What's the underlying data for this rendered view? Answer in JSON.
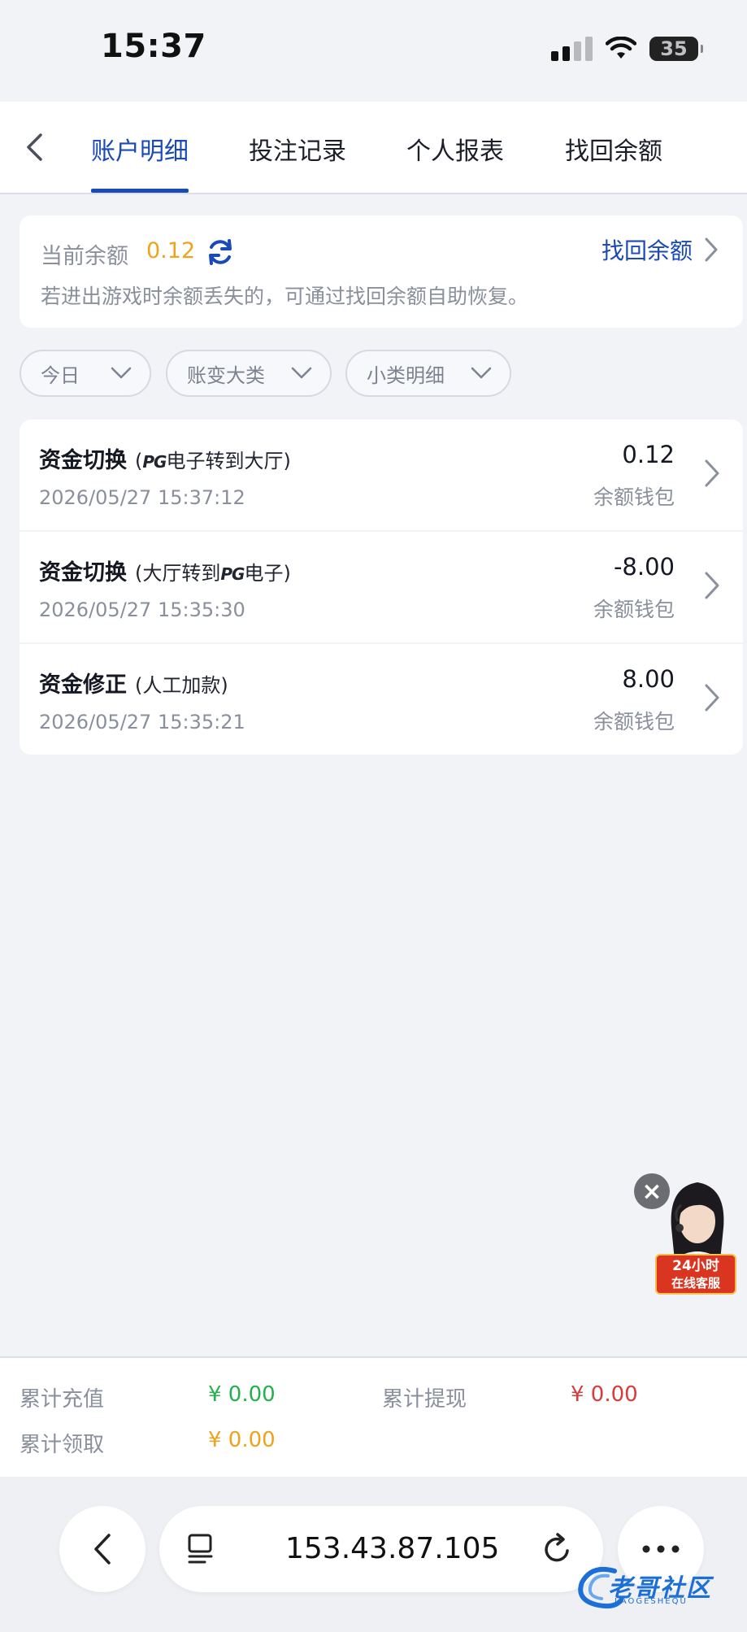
{
  "status_bar": {
    "time": "15:37",
    "battery": "35"
  },
  "tabs": [
    {
      "label": "账户明细",
      "active": true
    },
    {
      "label": "投注记录",
      "active": false
    },
    {
      "label": "个人报表",
      "active": false
    },
    {
      "label": "找回余额",
      "active": false
    }
  ],
  "balance": {
    "label": "当前余额",
    "value": "0.12",
    "recover_label": "找回余额",
    "hint": "若进出游戏时余额丢失的，可通过找回余额自助恢复。"
  },
  "filters": [
    {
      "label": "今日"
    },
    {
      "label": "账变大类"
    },
    {
      "label": "小类明细"
    }
  ],
  "records": [
    {
      "title": "资金切换",
      "sub_pre": "(",
      "sub_pg1": "PG",
      "sub_mid": "电子转到大厅)",
      "time": "2026/05/27 15:37:12",
      "amount": "0.12",
      "wallet": "余额钱包"
    },
    {
      "title": "资金切换",
      "sub_pre": "(大厅转到",
      "sub_pg1": "PG",
      "sub_mid": "电子)",
      "time": "2026/05/27 15:35:30",
      "amount": "-8.00",
      "wallet": "余额钱包"
    },
    {
      "title": "资金修正",
      "sub_pre": "(人工加款)",
      "sub_pg1": "",
      "sub_mid": "",
      "time": "2026/05/27 15:35:21",
      "amount": "8.00",
      "wallet": "余额钱包"
    }
  ],
  "customer_service": {
    "line1": "24小时",
    "line2": "在线客服"
  },
  "summary": {
    "deposit_label": "累计充值",
    "deposit_value": "¥ 0.00",
    "withdraw_label": "累计提现",
    "withdraw_value": "¥ 0.00",
    "claim_label": "累计领取",
    "claim_value": "¥ 0.00"
  },
  "browser": {
    "url": "153.43.87.105"
  },
  "watermark": {
    "text": "老哥社区",
    "sub": "LAOGESHEQU"
  },
  "colors": {
    "accent": "#1a49b8",
    "balance": "#f0a21b",
    "green": "#23b14d",
    "red": "#d93a3a"
  }
}
